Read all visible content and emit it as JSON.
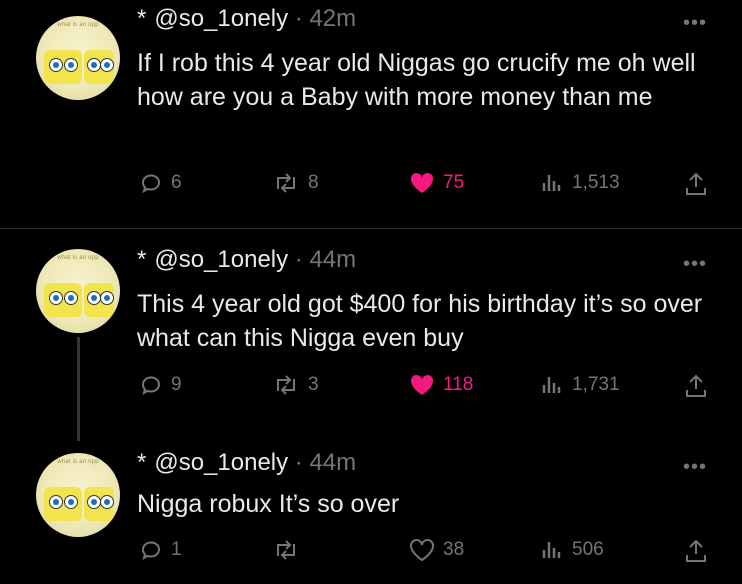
{
  "tweets": [
    {
      "avatar_caption": "what is an opp",
      "handle": "@so_1onely",
      "time": "42m",
      "star": "*",
      "more": "•••",
      "text": "If I rob this 4 year old  Niggas go crucify me oh well how are you a Baby with more money than me",
      "replies": "6",
      "retweets": "8",
      "likes": "75",
      "liked": true,
      "views": "1,513"
    },
    {
      "avatar_caption": "what is an opp",
      "handle": "@so_1onely",
      "time": "44m",
      "star": "*",
      "more": "•••",
      "text": "This 4 year old got $400 for his birthday it’s so over what can this Nigga even buy",
      "replies": "9",
      "retweets": "3",
      "likes": "118",
      "liked": true,
      "views": "1,731"
    },
    {
      "avatar_caption": "what is an opp",
      "handle": "@so_1onely",
      "time": "44m",
      "star": "*",
      "more": "•••",
      "text": "Nigga robux It’s so over",
      "replies": "1",
      "retweets": "",
      "likes": "38",
      "liked": false,
      "views": "506"
    }
  ],
  "colors": {
    "background": "#000000",
    "text": "#e7e9ea",
    "muted": "#71767b",
    "like_active": "#f91880",
    "divider": "#2f3336"
  },
  "icons": [
    "reply-icon",
    "retweet-icon",
    "like-icon",
    "views-icon",
    "share-icon",
    "more-icon"
  ]
}
